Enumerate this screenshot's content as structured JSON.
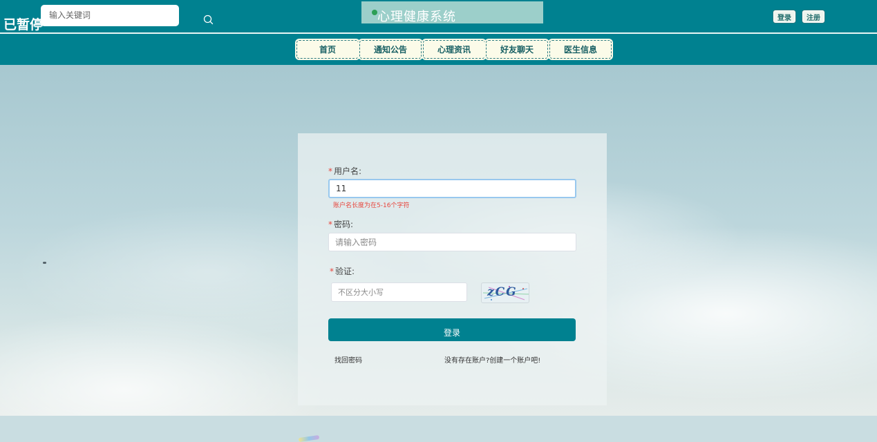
{
  "header": {
    "status_text": "已暂停",
    "search": {
      "placeholder": "输入关键词",
      "value": ""
    },
    "title": "心理健康系统",
    "login_button": "登录",
    "register_button": "注册"
  },
  "nav": {
    "items": [
      {
        "label": "首页"
      },
      {
        "label": "通知公告"
      },
      {
        "label": "心理资讯"
      },
      {
        "label": "好友聊天"
      },
      {
        "label": "医生信息"
      }
    ]
  },
  "login_form": {
    "username": {
      "label": "用户名:",
      "value": "11",
      "error": "账户名长度为在5-16个字符"
    },
    "password": {
      "label": "密码:",
      "placeholder": "请输入密码"
    },
    "captcha": {
      "label": "验证:",
      "placeholder": "不区分大小写",
      "code": "zCG"
    },
    "required_mark": "*",
    "submit_button": "登录",
    "forgot_link": "找回密码",
    "register_link": "没有存在账户?创建一个账户吧!"
  },
  "colors": {
    "primary": "#008190",
    "nav_button_bg": "#fbfbe9",
    "error": "#e8453c"
  }
}
